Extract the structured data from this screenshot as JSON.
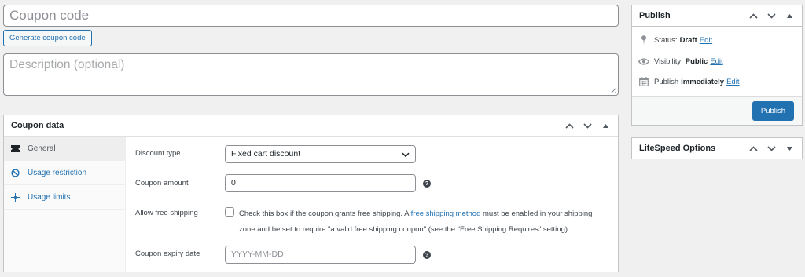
{
  "title_field": {
    "placeholder": "Coupon code"
  },
  "generate_button": "Generate coupon code",
  "description_field": {
    "placeholder": "Description (optional)"
  },
  "coupon_data": {
    "title": "Coupon data",
    "tabs": [
      {
        "label": "General",
        "icon": "ticket-icon",
        "active": true
      },
      {
        "label": "Usage restriction",
        "icon": "block-icon",
        "active": false
      },
      {
        "label": "Usage limits",
        "icon": "crosshair-icon",
        "active": false
      }
    ],
    "fields": {
      "discount_type": {
        "label": "Discount type",
        "value": "Fixed cart discount"
      },
      "coupon_amount": {
        "label": "Coupon amount",
        "value": "0"
      },
      "free_shipping": {
        "label": "Allow free shipping",
        "text_before": "Check this box if the coupon grants free shipping. A ",
        "link": "free shipping method",
        "text_after": " must be enabled in your shipping zone and be set to require \"a valid free shipping coupon\" (see the \"Free Shipping Requires\" setting).",
        "checked": false
      },
      "expiry_date": {
        "label": "Coupon expiry date",
        "placeholder": "YYYY-MM-DD"
      }
    },
    "help_glyph": "?"
  },
  "publish": {
    "title": "Publish",
    "status": {
      "label": "Status:",
      "value": "Draft",
      "edit": "Edit"
    },
    "visibility": {
      "label": "Visibility:",
      "value": "Public",
      "edit": "Edit"
    },
    "schedule": {
      "label": "Publish",
      "value": "immediately",
      "edit": "Edit"
    },
    "button": "Publish"
  },
  "litespeed": {
    "title": "LiteSpeed Options"
  },
  "colors": {
    "accent": "#2271b1",
    "background": "#f0f0f1",
    "border": "#c3c4c7"
  }
}
